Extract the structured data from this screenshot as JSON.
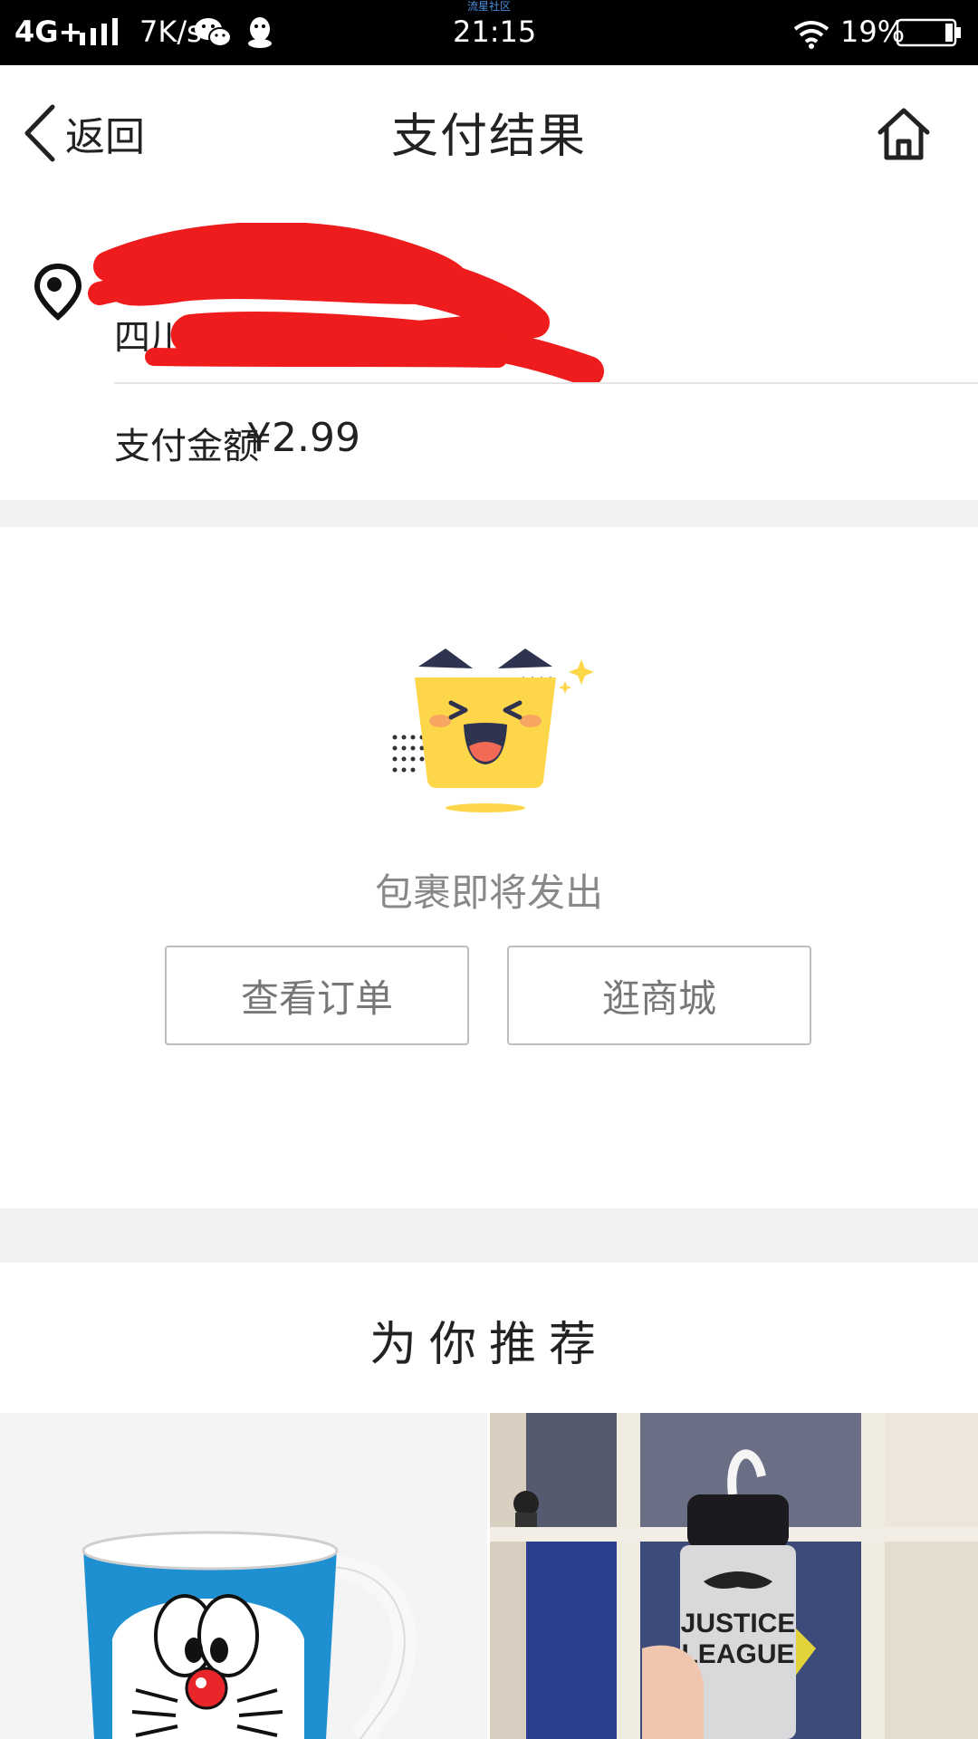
{
  "status_bar": {
    "network": "4G+",
    "speed": "7K/s",
    "carrier_label": "流星社区",
    "time": "21:15",
    "battery": "19%"
  },
  "header": {
    "back_label": "返回",
    "title": "支付结果"
  },
  "address": {
    "line1": "",
    "line2": "四川省"
  },
  "payment": {
    "label": "支付金额",
    "amount": "¥2.99"
  },
  "success": {
    "message": "包裹即将发出",
    "view_orders_label": "查看订单",
    "shop_label": "逛商城"
  },
  "recommend": {
    "title": "为你推荐",
    "products": [
      {
        "image": "doraemon-mug"
      },
      {
        "image": "justice-league-water-bottle",
        "print": "JUSTICE LEAGUE"
      }
    ]
  },
  "colors": {
    "accent_yellow": "#FDD64A",
    "redaction": "#EE1C1C",
    "divider": "#E5E5E5",
    "section_gap": "#F2F2F2"
  }
}
